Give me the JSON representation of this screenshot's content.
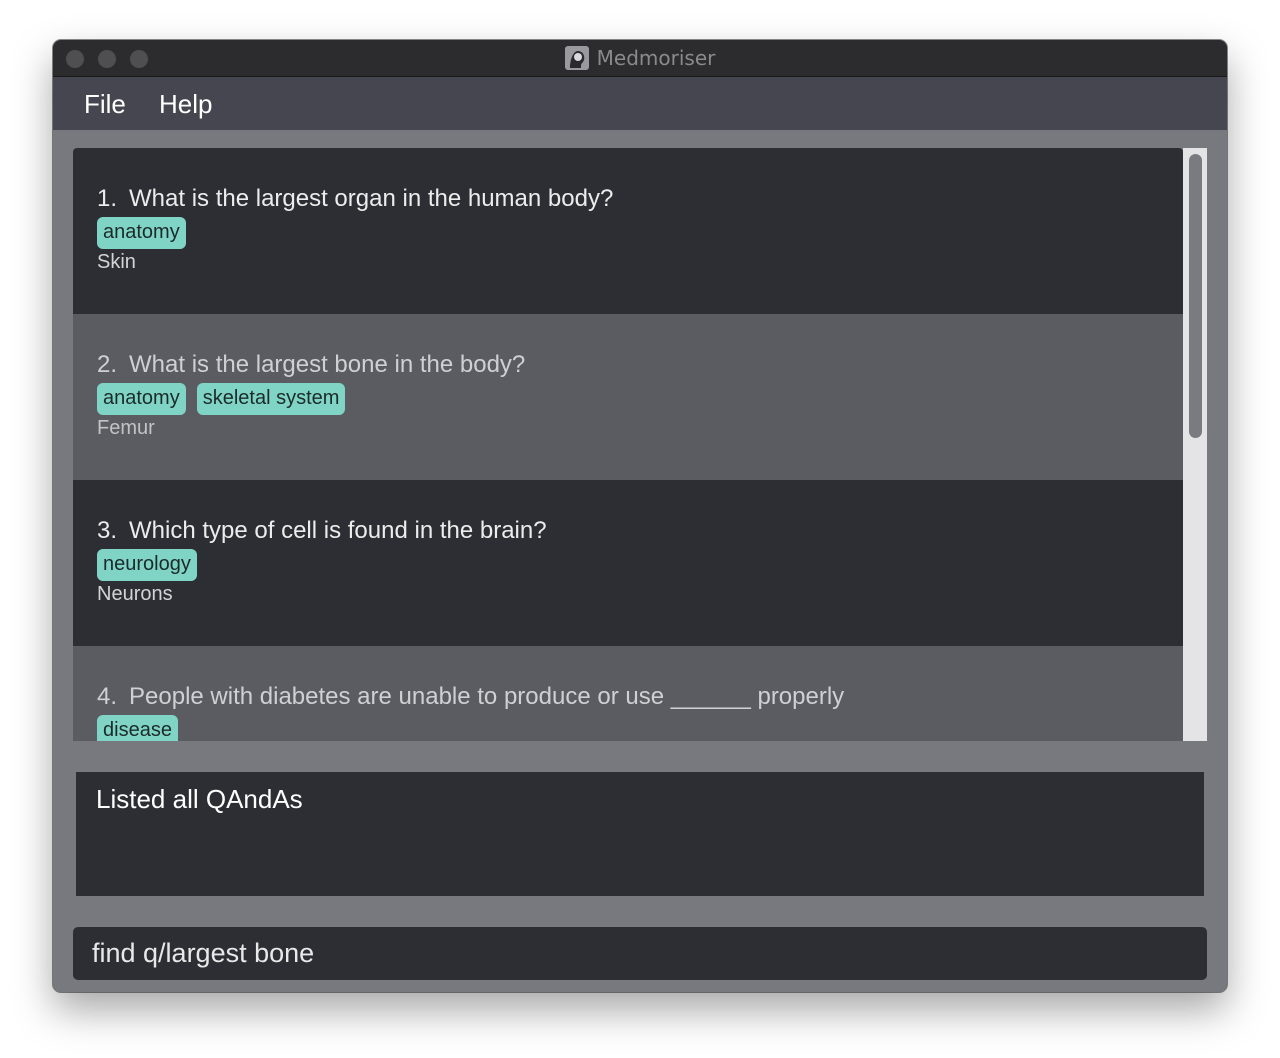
{
  "window": {
    "title": "Medmoriser"
  },
  "menu": {
    "file": "File",
    "help": "Help"
  },
  "qandas": [
    {
      "number": "1.",
      "question": "What is the largest organ in the human body?",
      "tags": [
        "anatomy"
      ],
      "answer": "Skin"
    },
    {
      "number": "2.",
      "question": "What is the largest bone in the body?",
      "tags": [
        "anatomy",
        "skeletal system"
      ],
      "answer": "Femur"
    },
    {
      "number": "3.",
      "question": "Which type of cell is found in the brain?",
      "tags": [
        "neurology"
      ],
      "answer": "Neurons"
    },
    {
      "number": "4.",
      "question": "People with diabetes are unable to produce or use ______ properly",
      "tags": [
        "disease"
      ],
      "answer": ""
    }
  ],
  "result": {
    "message": "Listed all QAndAs"
  },
  "command": {
    "value": "find q/largest bone"
  },
  "colors": {
    "tag_bg": "#7fd4c5",
    "card_dark": "#2d2e34",
    "card_light": "#5b5c62",
    "menubar": "#45464f",
    "window_bg": "#78797e"
  }
}
